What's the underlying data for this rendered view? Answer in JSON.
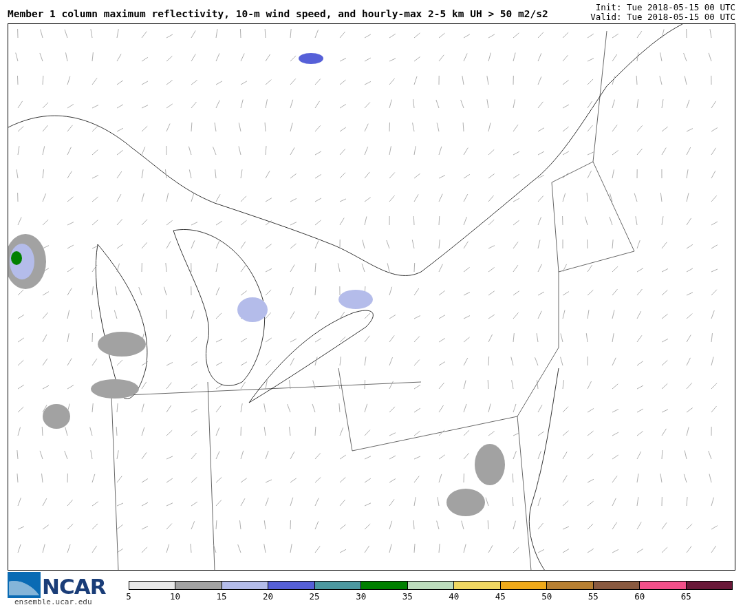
{
  "title": "Member 1 column maximum reflectivity, 10-m wind speed, and hourly-max 2-5 km UH > 50 m2/s2",
  "init": "Init: Tue 2018-05-15 00 UTC",
  "valid": "Valid: Tue 2018-05-15 00 UTC",
  "logo": {
    "name": "NCAR",
    "url": "ensemble.ucar.edu"
  },
  "legend": [
    {
      "color": "#e8e8e8",
      "label": "5"
    },
    {
      "color": "#a2a2a2",
      "label": "10"
    },
    {
      "color": "#b4bcea",
      "label": "15"
    },
    {
      "color": "#5660d8",
      "label": "20"
    },
    {
      "color": "#4c98a0",
      "label": "25"
    },
    {
      "color": "#008000",
      "label": "30"
    },
    {
      "color": "#bcdcbc",
      "label": "35"
    },
    {
      "color": "#f0d862",
      "label": "40"
    },
    {
      "color": "#f0aa1a",
      "label": "45"
    },
    {
      "color": "#b88032",
      "label": "50"
    },
    {
      "color": "#8a5a40",
      "label": "55"
    },
    {
      "color": "#f4508a",
      "label": "60"
    },
    {
      "color": "#6a1838",
      "label": "65"
    }
  ]
}
